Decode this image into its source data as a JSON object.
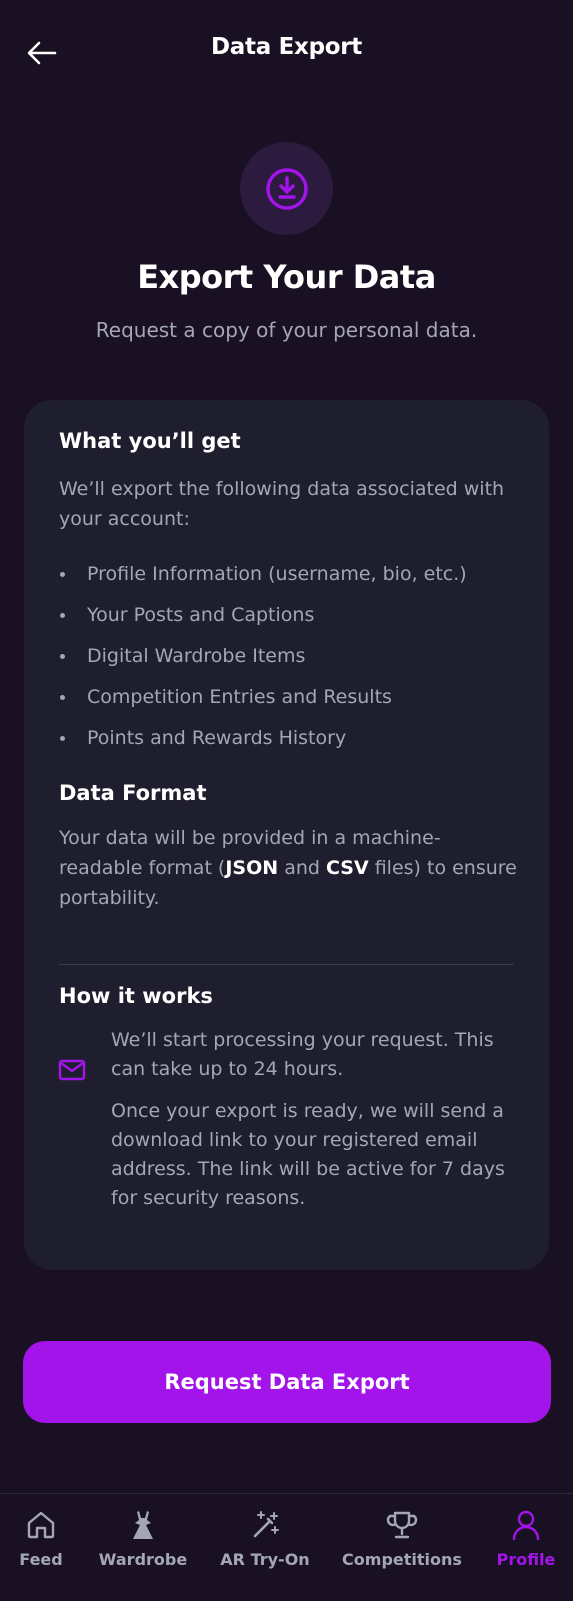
{
  "header": {
    "title": "Data Export"
  },
  "hero": {
    "title": "Export Your Data",
    "subtitle": "Request a copy of your personal data."
  },
  "card": {
    "get_title": "What you’ll get",
    "get_intro": "We’ll export the following data associated with your account:",
    "items": [
      "Profile Information (username, bio, etc.)",
      "Your Posts and Captions",
      "Digital Wardrobe Items",
      "Competition Entries and Results",
      "Points and Rewards History"
    ],
    "format_title": "Data Format",
    "format_pre": "Your data will be provided in a machine-readable format (",
    "format_json": "JSON",
    "format_and": " and ",
    "format_csv": "CSV",
    "format_post": " files) to ensure portability.",
    "how_title": "How it works",
    "how_step1": "We’ll start processing your request. This can take up to 24 hours.",
    "how_step2": "Once your export is ready, we will send a download link to your registered email address. The link will be active for 7 days for security reasons."
  },
  "button": {
    "label": "Request Data Export"
  },
  "tabs": [
    {
      "label": "Feed",
      "icon": "home-icon"
    },
    {
      "label": "Wardrobe",
      "icon": "dress-icon"
    },
    {
      "label": "AR Try-On",
      "icon": "magic-wand-icon"
    },
    {
      "label": "Competitions",
      "icon": "trophy-icon"
    },
    {
      "label": "Profile",
      "icon": "person-icon",
      "active": true
    }
  ],
  "colors": {
    "background": "#1a1023",
    "card": "#1f1e2e",
    "accent": "#a214e9",
    "muted_text": "#a3a6b6"
  }
}
